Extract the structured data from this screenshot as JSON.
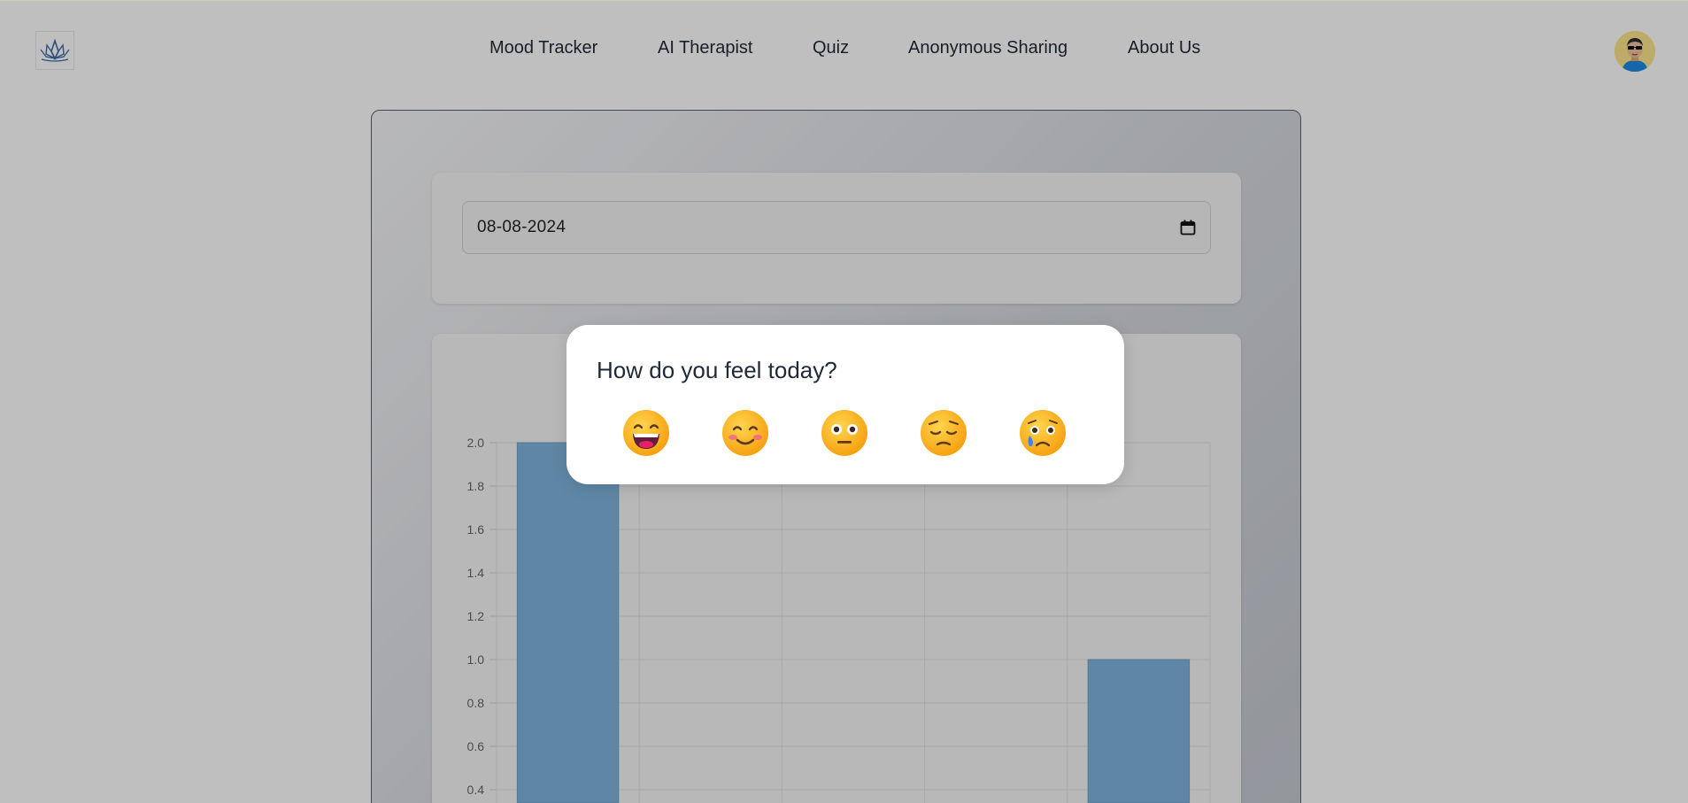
{
  "nav": {
    "items": [
      {
        "label": "Mood Tracker"
      },
      {
        "label": "AI Therapist"
      },
      {
        "label": "Quiz"
      },
      {
        "label": "Anonymous Sharing"
      },
      {
        "label": "About Us"
      }
    ]
  },
  "date_picker": {
    "value": "08-08-2024",
    "icon": "calendar-icon"
  },
  "mood_modal": {
    "title": "How do you feel today?",
    "options": [
      {
        "icon": "grinning-face-icon"
      },
      {
        "icon": "smiling-face-icon"
      },
      {
        "icon": "neutral-face-icon"
      },
      {
        "icon": "pensive-face-icon"
      },
      {
        "icon": "crying-face-icon"
      }
    ]
  },
  "colors": {
    "bar": "#7fb5dc",
    "overlay": "rgba(0,0,0,0.25)",
    "emoji_yellow": "#f9a825"
  },
  "chart_data": {
    "type": "bar",
    "categories": [
      "",
      "",
      "",
      "",
      ""
    ],
    "values": [
      2,
      null,
      null,
      null,
      1
    ],
    "ylim": [
      0,
      2
    ],
    "y_ticks": [
      "2.0",
      "1.8",
      "1.6",
      "1.4",
      "1.2",
      "1.0",
      "0.8",
      "0.6",
      "0.4"
    ],
    "grid": true,
    "legend": "none"
  }
}
